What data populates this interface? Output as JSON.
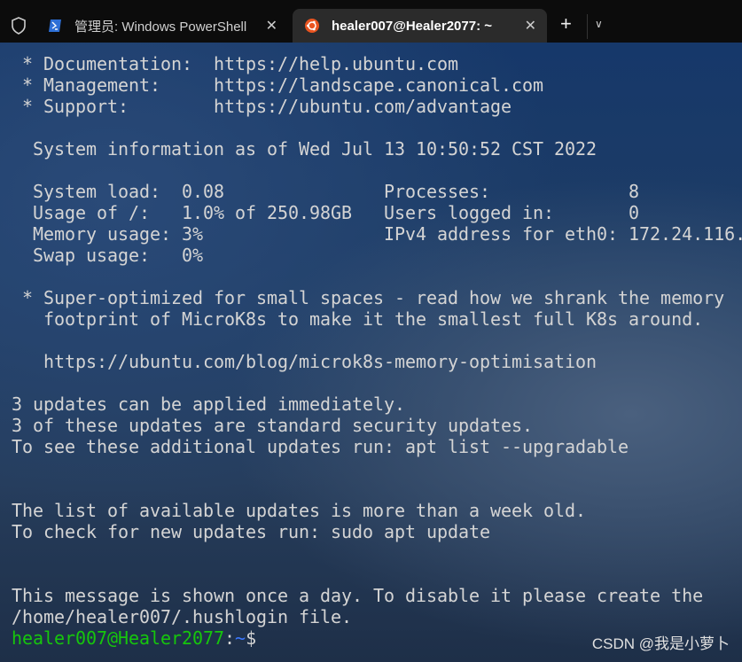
{
  "tabs": [
    {
      "title": "管理员: Windows PowerShell",
      "icon": "powershell-icon",
      "active": false
    },
    {
      "title": "healer007@Healer2077: ~",
      "icon": "ubuntu-icon",
      "active": true
    }
  ],
  "terminal": {
    "lines": [
      " * Documentation:  https://help.ubuntu.com",
      " * Management:     https://landscape.canonical.com",
      " * Support:        https://ubuntu.com/advantage",
      "",
      "  System information as of Wed Jul 13 10:50:52 CST 2022",
      "",
      "  System load:  0.08               Processes:             8",
      "  Usage of /:   1.0% of 250.98GB   Users logged in:       0",
      "  Memory usage: 3%                 IPv4 address for eth0: 172.24.116.",
      "  Swap usage:   0%",
      "",
      " * Super-optimized for small spaces - read how we shrank the memory",
      "   footprint of MicroK8s to make it the smallest full K8s around.",
      "",
      "   https://ubuntu.com/blog/microk8s-memory-optimisation",
      "",
      "3 updates can be applied immediately.",
      "3 of these updates are standard security updates.",
      "To see these additional updates run: apt list --upgradable",
      "",
      "",
      "The list of available updates is more than a week old.",
      "To check for new updates run: sudo apt update",
      "",
      "",
      "This message is shown once a day. To disable it please create the",
      "/home/healer007/.hushlogin file."
    ],
    "prompt": {
      "user_host": "healer007@Healer2077",
      "colon": ":",
      "path": "~",
      "symbol": "$"
    },
    "colors": {
      "user_host": "#16c60c",
      "path": "#3b78ff",
      "text": "#d4d4d4"
    }
  },
  "watermark": "CSDN @我是小萝卜"
}
